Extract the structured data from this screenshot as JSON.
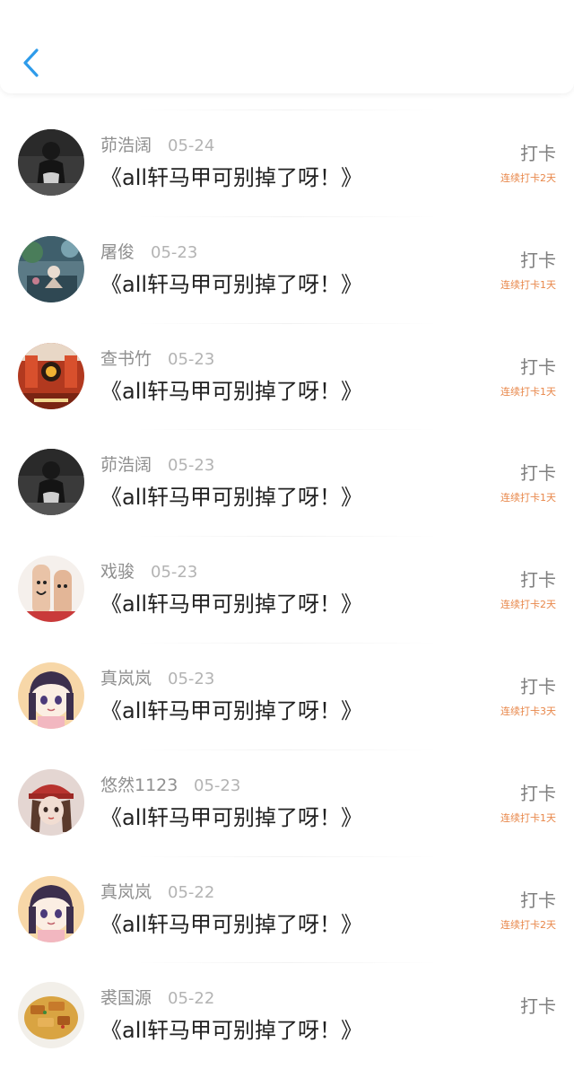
{
  "header": {
    "back_icon": "chevron-left-icon",
    "accent_color": "#2e9bea"
  },
  "records": [
    {
      "name": "茆浩阔",
      "date": "05-24",
      "title": "《all轩马甲可别掉了呀！》",
      "checkin_label": "打卡",
      "streak": "连续打卡2天",
      "avatar_style": "dark-figure"
    },
    {
      "name": "屠俊",
      "date": "05-23",
      "title": "《all轩马甲可别掉了呀！》",
      "checkin_label": "打卡",
      "streak": "连续打卡1天",
      "avatar_style": "anime-scene"
    },
    {
      "name": "查书竹",
      "date": "05-23",
      "title": "《all轩马甲可别掉了呀！》",
      "checkin_label": "打卡",
      "streak": "连续打卡1天",
      "avatar_style": "red-room"
    },
    {
      "name": "茆浩阔",
      "date": "05-23",
      "title": "《all轩马甲可别掉了呀！》",
      "checkin_label": "打卡",
      "streak": "连续打卡1天",
      "avatar_style": "dark-figure"
    },
    {
      "name": "戏骏",
      "date": "05-23",
      "title": "《all轩马甲可别掉了呀！》",
      "checkin_label": "打卡",
      "streak": "连续打卡2天",
      "avatar_style": "finger-doodle"
    },
    {
      "name": "真岚岚",
      "date": "05-23",
      "title": "《all轩马甲可别掉了呀！》",
      "checkin_label": "打卡",
      "streak": "连续打卡3天",
      "avatar_style": "anime-girl"
    },
    {
      "name": "悠然1123",
      "date": "05-23",
      "title": "《all轩马甲可别掉了呀！》",
      "checkin_label": "打卡",
      "streak": "连续打卡1天",
      "avatar_style": "red-hat-girl"
    },
    {
      "name": "真岚岚",
      "date": "05-22",
      "title": "《all轩马甲可别掉了呀！》",
      "checkin_label": "打卡",
      "streak": "连续打卡2天",
      "avatar_style": "anime-girl"
    },
    {
      "name": "裘国源",
      "date": "05-22",
      "title": "《all轩马甲可别掉了呀！》",
      "checkin_label": "打卡",
      "streak": "",
      "avatar_style": "food"
    }
  ]
}
